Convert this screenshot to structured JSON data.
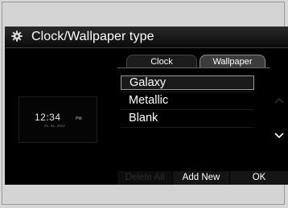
{
  "title_bar": {
    "title": "Clock/Wallpaper type",
    "icon": "gear-icon"
  },
  "tabs": [
    {
      "label": "Clock",
      "active": false
    },
    {
      "label": "Wallpaper",
      "active": true
    }
  ],
  "preview": {
    "time": "12:34",
    "ampm": "PM",
    "date": "25. 04. 2012"
  },
  "wallpaper_list": {
    "items": [
      {
        "label": "Galaxy",
        "selected": true
      },
      {
        "label": "Metallic",
        "selected": false
      },
      {
        "label": "Blank",
        "selected": false
      }
    ],
    "scroll_up_icon": "chevron-up-icon",
    "scroll_down_icon": "chevron-down-icon"
  },
  "buttons": {
    "delete_all": "Delete All",
    "add_new": "Add New",
    "ok": "OK"
  },
  "colors": {
    "screen_bg": "#000000",
    "text": "#ffffff",
    "disabled_text": "#2d2d2d",
    "frame_bg": "#d4d4d4"
  }
}
